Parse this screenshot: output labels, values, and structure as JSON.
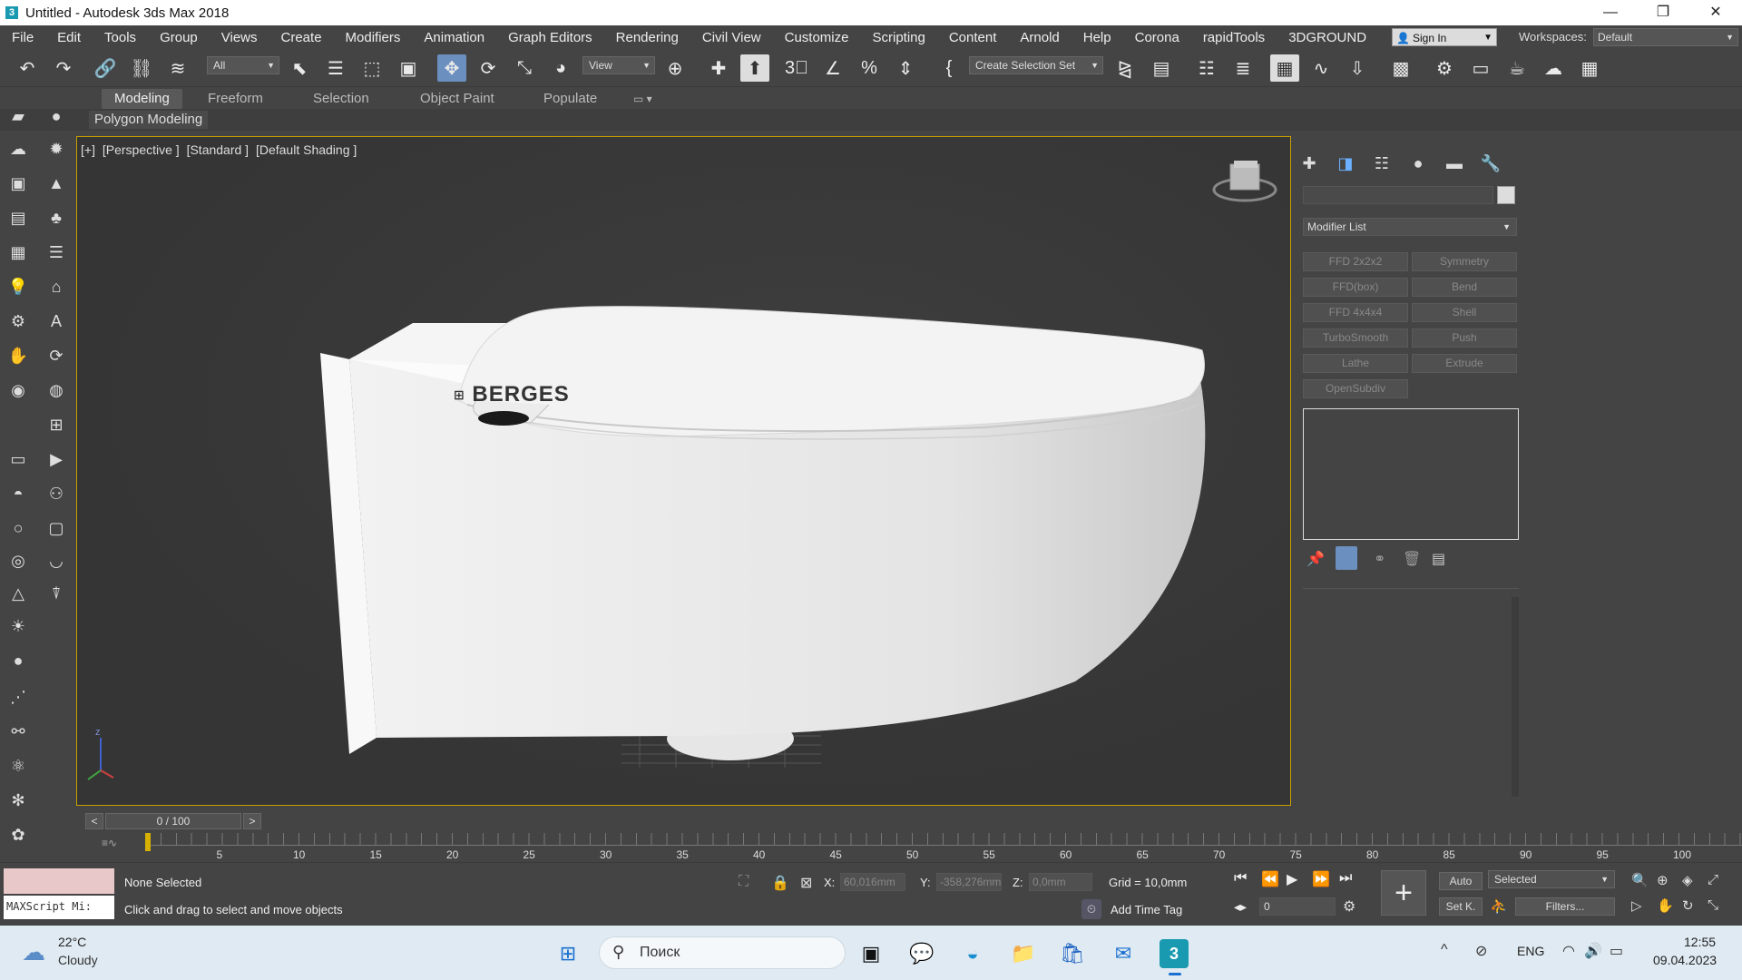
{
  "window": {
    "title": "Untitled - Autodesk 3ds Max 2018",
    "app_icon": "3",
    "minimize": "—",
    "restore": "❐",
    "close": "✕"
  },
  "menu": {
    "items": [
      "File",
      "Edit",
      "Tools",
      "Group",
      "Views",
      "Create",
      "Modifiers",
      "Animation",
      "Graph Editors",
      "Rendering",
      "Civil View",
      "Customize",
      "Scripting",
      "Content",
      "Arnold",
      "Help",
      "Corona",
      "rapidTools",
      "3DGROUND"
    ],
    "sign_in": "Sign In",
    "workspaces_label": "Workspaces:",
    "workspace_value": "Default"
  },
  "toolbar": {
    "selection_filter": "All",
    "ref_coord": "View",
    "selection_set": "Create Selection Set"
  },
  "ribbon": {
    "tabs": [
      "Modeling",
      "Freeform",
      "Selection",
      "Object Paint",
      "Populate"
    ],
    "active_tab": "Modeling",
    "sub_label": "Polygon Modeling"
  },
  "viewport": {
    "label_plus": "[+]",
    "label_view": "[Perspective ]",
    "label_standard": "[Standard ]",
    "label_shading": "[Default Shading ]",
    "brand_text": "BERGES",
    "axis_z": "z"
  },
  "command_panel": {
    "name_field": "",
    "modifier_list": "Modifier List",
    "modifier_buttons": [
      "FFD 2x2x2",
      "Symmetry",
      "FFD(box)",
      "Bend",
      "FFD 4x4x4",
      "Shell",
      "TurboSmooth",
      "Push",
      "Lathe",
      "Extrude",
      "OpenSubdiv"
    ]
  },
  "timeline": {
    "frame_display": "0 / 100",
    "prev": "<",
    "next": ">",
    "ticks": [
      "5",
      "10",
      "15",
      "20",
      "25",
      "30",
      "35",
      "40",
      "45",
      "50",
      "55",
      "60",
      "65",
      "70",
      "75",
      "80",
      "85",
      "90",
      "95",
      "100"
    ]
  },
  "status": {
    "maxscript": "MAXScript Mi:",
    "selection": "None Selected",
    "prompt": "Click and drag to select and move objects",
    "x_label": "X:",
    "x_value": "60,016mm",
    "y_label": "Y:",
    "y_value": "-358,276mm",
    "z_label": "Z:",
    "z_value": "0,0mm",
    "grid": "Grid = 10,0mm",
    "add_time_tag": "Add Time Tag",
    "auto": "Auto",
    "set_k": "Set K.",
    "selected": "Selected",
    "filters": "Filters...",
    "frame_value": "0"
  },
  "taskbar": {
    "temperature": "22°C",
    "weather": "Cloudy",
    "search_placeholder": "Поиск",
    "language": "ENG",
    "time": "12:55",
    "date": "09.04.2023"
  }
}
